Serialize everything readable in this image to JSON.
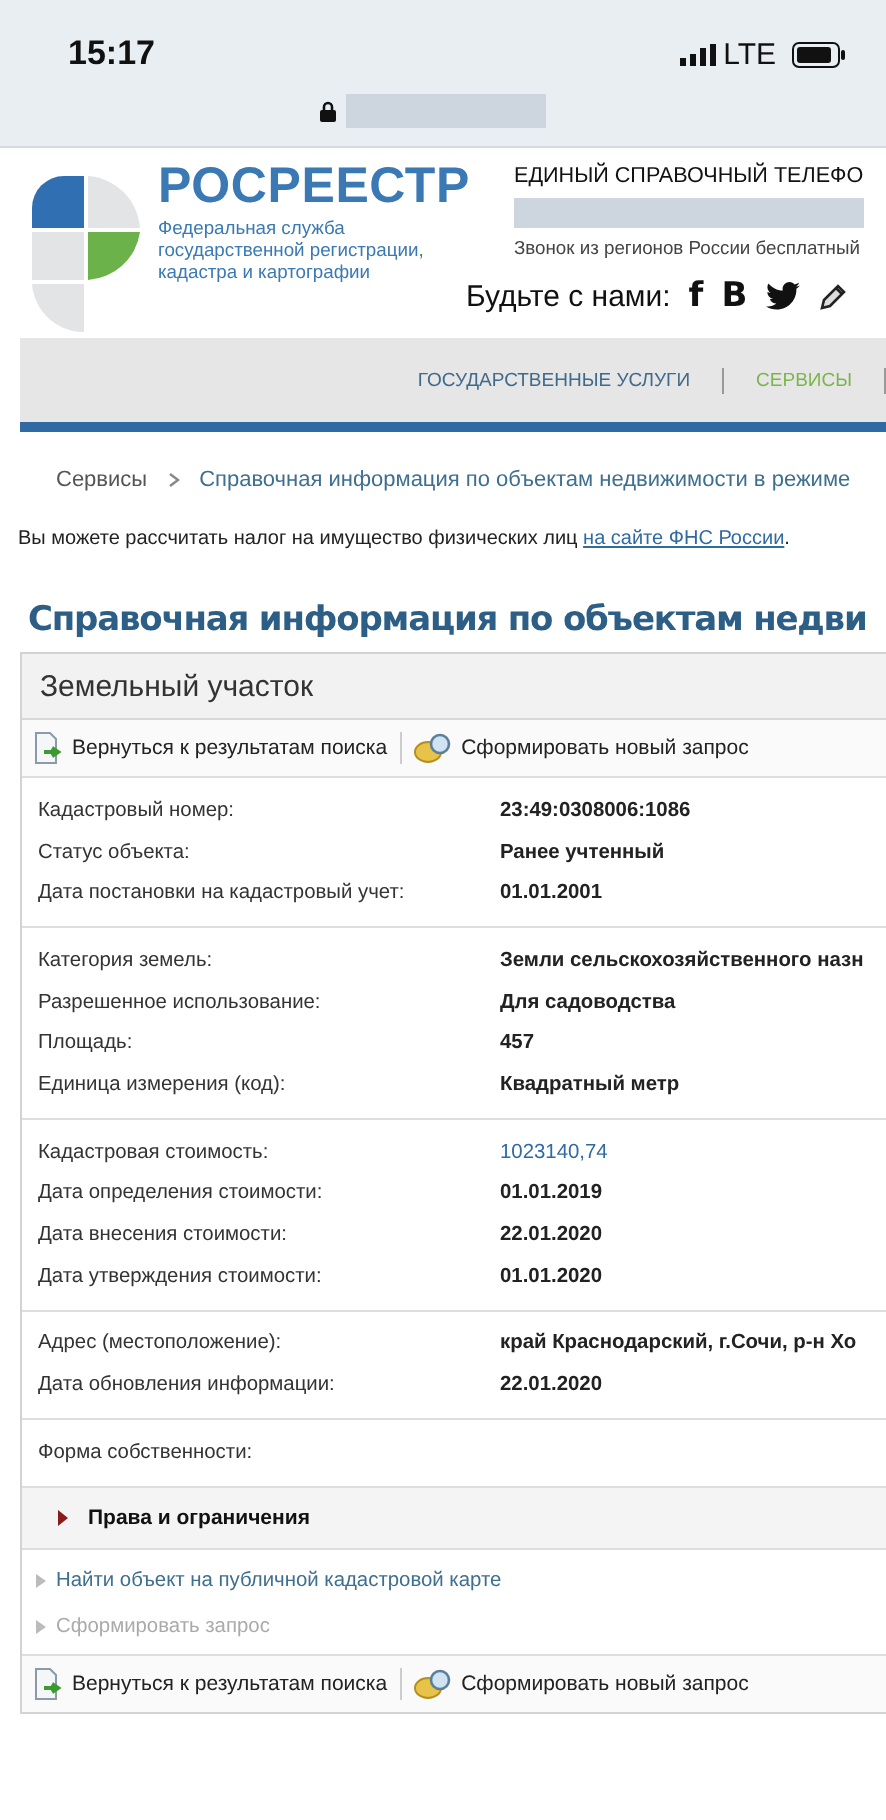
{
  "status_bar": {
    "time": "15:17",
    "network": "LTE"
  },
  "header": {
    "brand": "РОСРЕЕСТР",
    "subtitle_lines": [
      "Федеральная служба",
      "государственной регистрации,",
      "кадастра и картографии"
    ],
    "hotline_title": "ЕДИНЫЙ СПРАВОЧНЫЙ ТЕЛЕФО",
    "hotline_note": "Звонок из регионов России бесплатный",
    "social_label": "Будьте с нами:",
    "social": [
      {
        "kind": "glyph",
        "text": "f"
      },
      {
        "kind": "glyph",
        "text": "В"
      },
      {
        "kind": "twitter"
      },
      {
        "kind": "pencil"
      }
    ]
  },
  "nav": [
    {
      "label": "ГОСУДАРСТВЕННЫЕ УСЛУГИ",
      "selected": false
    },
    {
      "label": "СЕРВИСЫ",
      "selected": true
    }
  ],
  "breadcrumb": [
    "Сервисы",
    "Справочная информация по объектам недвижимости в режиме"
  ],
  "notice": {
    "text": "Вы можете рассчитать налог на имущество физических лиц ",
    "link": "на сайте ФНС России",
    "end": "."
  },
  "heading": "Справочная информация по объектам недви",
  "panel": {
    "title": "Земельный участок",
    "toolbar": [
      "Вернуться к результатам поиска",
      "Сформировать новый запрос"
    ],
    "groups": [
      [
        {
          "label": "Кадастровый номер:",
          "value": "23:49:0308006:1086",
          "kind": "text"
        },
        {
          "label": "Статус объекта:",
          "value": "Ранее учтенный",
          "kind": "text"
        },
        {
          "label": "Дата постановки на кадастровый учет:",
          "value": "01.01.2001",
          "kind": "text"
        }
      ],
      [
        {
          "label": "Категория земель:",
          "value": "Земли сельскохозяйственного назн",
          "kind": "text"
        },
        {
          "label": "Разрешенное использование:",
          "value": "Для садоводства",
          "kind": "text"
        },
        {
          "label": "Площадь:",
          "value": "457",
          "kind": "text"
        },
        {
          "label": "Единица измерения (код):",
          "value": "Квадратный метр",
          "kind": "text"
        }
      ],
      [
        {
          "label": "Кадастровая стоимость:",
          "value": "1023140,74",
          "kind": "link"
        },
        {
          "label": "Дата определения стоимости:",
          "value": "01.01.2019",
          "kind": "text"
        },
        {
          "label": "Дата внесения стоимости:",
          "value": "22.01.2020",
          "kind": "text"
        },
        {
          "label": "Дата утверждения стоимости:",
          "value": "01.01.2020",
          "kind": "text"
        }
      ],
      [
        {
          "label": "Адрес (местоположение):",
          "value": "край Краснодарский, г.Сочи, р-н Хо",
          "kind": "text"
        },
        {
          "label": "Дата обновления информации:",
          "value": "22.01.2020",
          "kind": "text"
        }
      ],
      [
        {
          "label": "Форма собственности:"
        }
      ]
    ],
    "section": {
      "title": "Права и ограничения",
      "expanded": false
    },
    "links": [
      {
        "label": "Найти объект на публичной кадастровой карте",
        "disabled": false
      },
      {
        "label": "Сформировать запрос",
        "disabled": true
      }
    ],
    "bottom_toolbar": [
      "Вернуться к результатам поиска",
      "Сформировать новый запрос"
    ]
  }
}
